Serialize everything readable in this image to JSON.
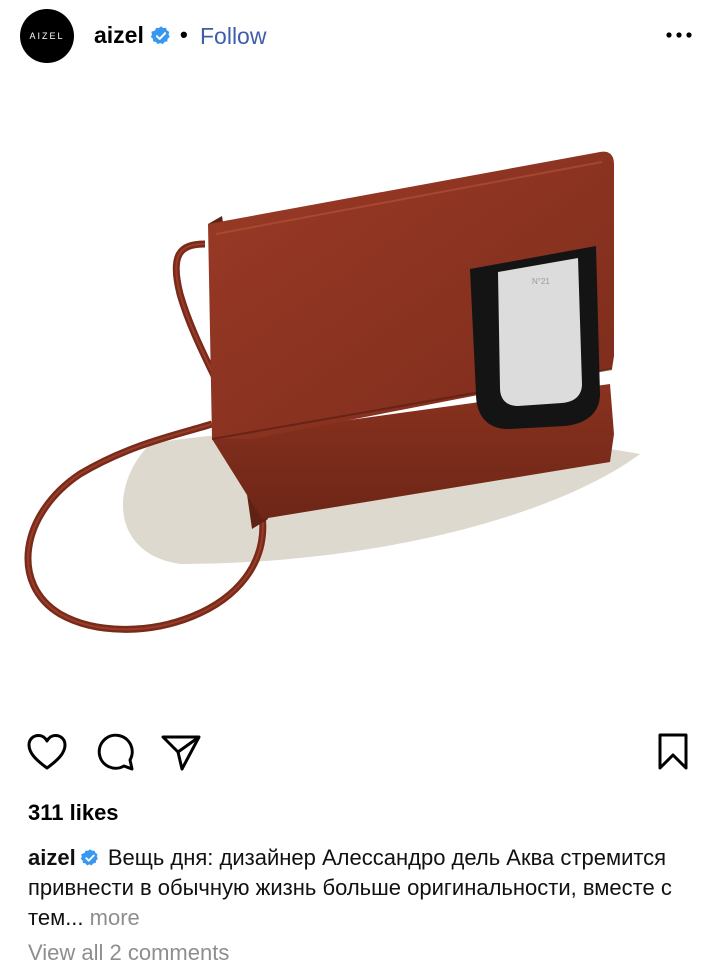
{
  "header": {
    "avatar_text": "AIZEL",
    "username": "aizel",
    "separator": "•",
    "follow_label": "Follow"
  },
  "post": {
    "likes": "311 likes",
    "caption_user": "aizel",
    "caption_text": "Вещь дня: дизайнер Алессандро дель Аква стремится привнести в обычную жизнь больше оригинальности, вместе с тем...",
    "more_label": "more",
    "view_comments": "View all 2 comments",
    "tab_text": "N°21"
  },
  "colors": {
    "follow": "#3f5ea8",
    "verified": "#3897f0",
    "bag": "#8e3322",
    "muted": "#8e8e8e"
  },
  "icons": [
    "verified-badge-icon",
    "more-options-icon",
    "heart-icon",
    "comment-icon",
    "share-icon",
    "bookmark-icon"
  ]
}
